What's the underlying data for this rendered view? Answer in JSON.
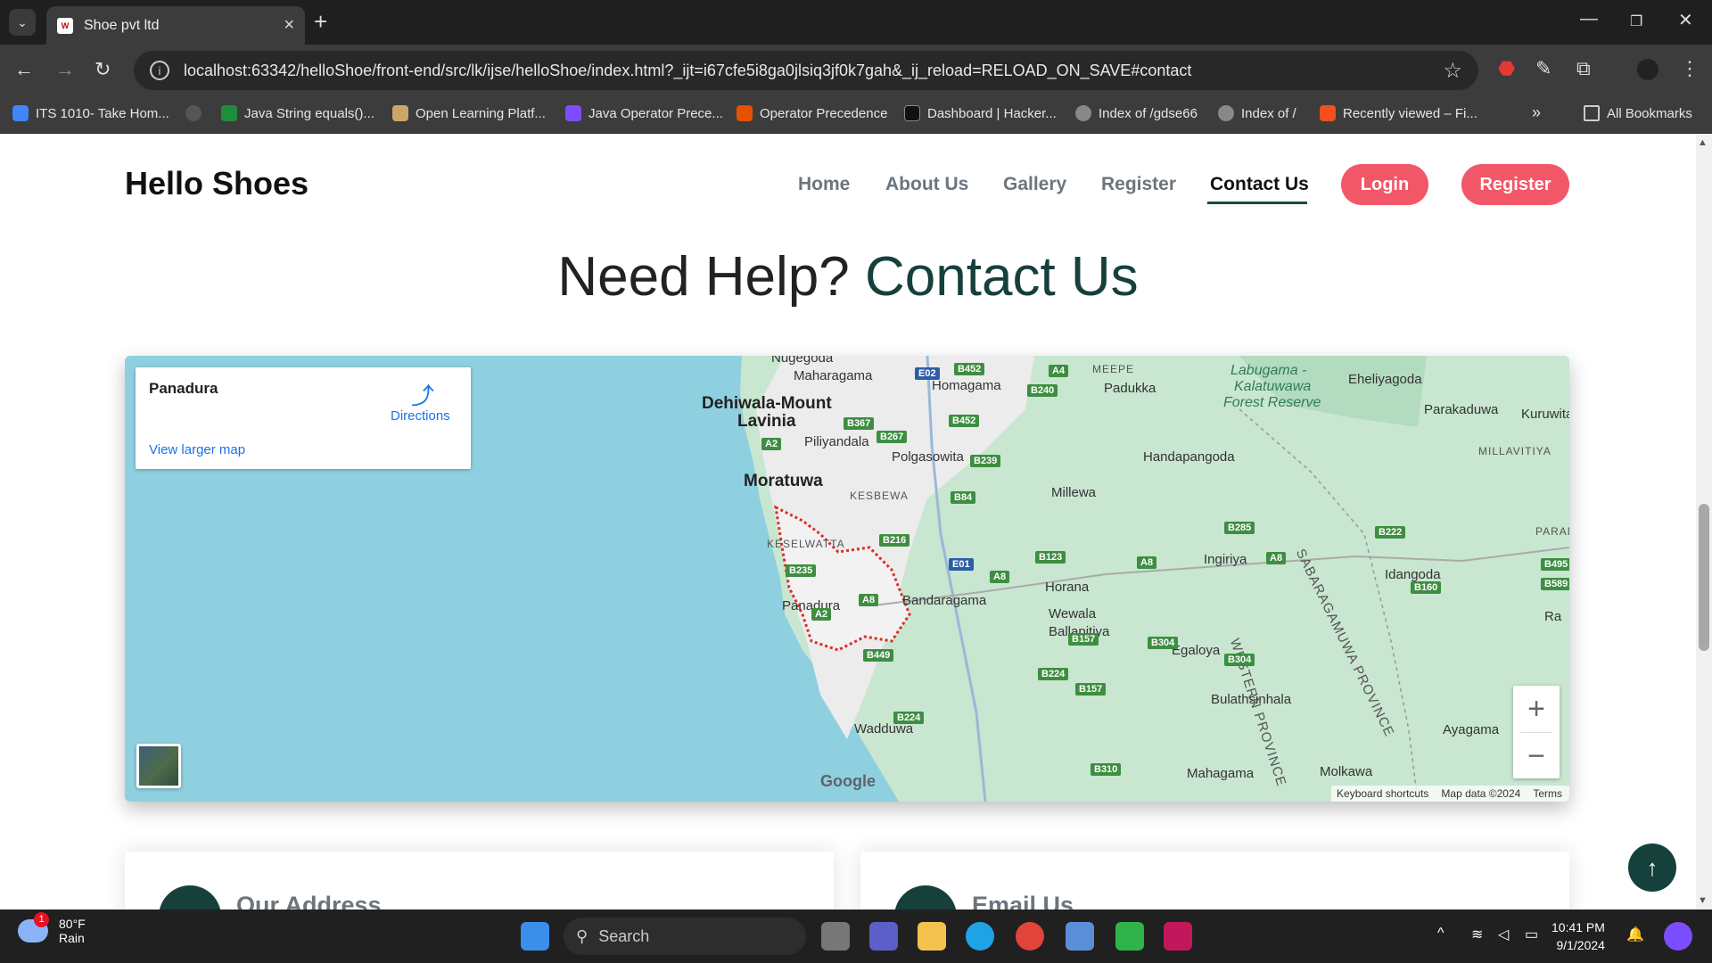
{
  "browser": {
    "tab_title": "Shoe pvt ltd",
    "url": "localhost:63342/helloShoe/front-end/src/lk/ijse/helloShoe/index.html?_ijt=i67cfe5i8ga0jlsiq3jf0k7gah&_ij_reload=RELOAD_ON_SAVE#contact",
    "bookmarks": [
      "ITS 1010- Take Hom...",
      "Java String equals()...",
      "Open Learning Platf...",
      "Java Operator Prece...",
      "Operator Precedence",
      "Dashboard | Hacker...",
      "Index of /gdse66",
      "Index of /",
      "Recently viewed – Fi..."
    ],
    "all_bookmarks": "All Bookmarks"
  },
  "site": {
    "brand": "Hello Shoes",
    "nav": [
      "Home",
      "About Us",
      "Gallery",
      "Register",
      "Contact Us"
    ],
    "login_btn": "Login",
    "register_btn": "Register",
    "heading_plain": "Need Help?",
    "heading_accent": "Contact Us"
  },
  "map": {
    "place": "Panadura",
    "directions": "Directions",
    "larger_map": "View larger map",
    "google": "Google",
    "footer": [
      "Keyboard shortcuts",
      "Map data ©2024",
      "Terms"
    ],
    "labels": {
      "nugegoda": "Nugegoda",
      "maharagama": "Maharagama",
      "homagama": "Homagama",
      "meepe": "MEEPE",
      "padukka": "Padukka",
      "labugama": "Labugama -",
      "kalatuwawa": "Kalatuwawa",
      "forest": "Forest Reserve",
      "eheliyagoda": "Eheliyagoda",
      "dehiwala": "Dehiwala-Mount",
      "lavinia": "Lavinia",
      "parakaduwa": "Parakaduwa",
      "kuruwita": "Kuruwita",
      "piliyandala": "Piliyandala",
      "millavitiya": "MILLAVITIYA",
      "moratuwa": "Moratuwa",
      "polgasowita": "Polgasowita",
      "handapangoda": "Handapangoda",
      "kesbewa": "KESBEWA",
      "millewa": "Millewa",
      "keselwatta": "KESELWATTA",
      "parad": "PARAD",
      "ingiriya": "Ingiriya",
      "idangoda": "Idangoda",
      "horana": "Horana",
      "bandaragama": "Bandaragama",
      "panadura": "Panadura",
      "wewala": "Wewala",
      "ballapitiya": "Ballapitiya",
      "egaloya": "Egaloya",
      "bulathsinhala": "Bulathsinhala",
      "wadduwa": "Wadduwa",
      "ayagama": "Ayagama",
      "mahagama": "Mahagama",
      "molkawa": "Molkawa",
      "ra": "Ra",
      "western": "WESTERN PROVINCE",
      "sabaragamuwa": "SABARAGAMUWA PROVINCE"
    },
    "roads": {
      "b452a": "B452",
      "e02": "E02",
      "a4": "A4",
      "b240": "B240",
      "b367": "B367",
      "b452b": "B452",
      "b267": "B267",
      "a2a": "A2",
      "b239": "B239",
      "b84": "B84",
      "b285": "B285",
      "b222": "B222",
      "b216": "B216",
      "b495": "B495",
      "e01": "E01",
      "b123": "B123",
      "a8a": "A8",
      "a8b": "A8",
      "b235": "B235",
      "a8c": "A8",
      "b589": "B589",
      "a8d": "A8",
      "b160": "B160",
      "a2b": "A2",
      "b157a": "B157",
      "b304a": "B304",
      "b449": "B449",
      "b304b": "B304",
      "b224a": "B224",
      "b157b": "B157",
      "b224b": "B224",
      "b310": "B310"
    }
  },
  "cards": {
    "address_title": "Our Address",
    "email_title": "Email Us"
  },
  "taskbar": {
    "temp": "80°F",
    "condition": "Rain",
    "weather_badge": "1",
    "search": "Search",
    "time": "10:41 PM",
    "date": "9/1/2024"
  }
}
